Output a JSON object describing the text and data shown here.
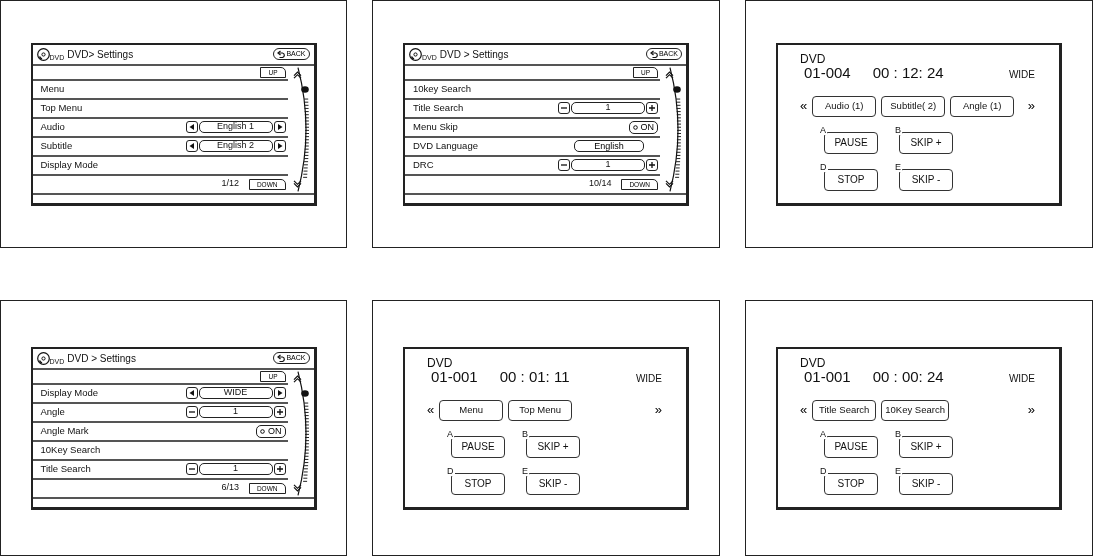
{
  "panels": [
    {
      "kind": "settings",
      "icon_label": "DVD",
      "breadcrumb": "DVD> Settings",
      "back": "BACK",
      "up": "UP",
      "rows": [
        {
          "kind": "plain",
          "label": "Menu"
        },
        {
          "kind": "plain",
          "label": "Top Menu"
        },
        {
          "kind": "arrows",
          "label": "Audio",
          "value": "English  1"
        },
        {
          "kind": "arrows",
          "label": "Subtitle",
          "value": "English  2"
        },
        {
          "kind": "plain",
          "label": "Display Mode"
        }
      ],
      "page": "1/12",
      "down": "DOWN"
    },
    {
      "kind": "settings",
      "icon_label": "DVD",
      "breadcrumb": "DVD > Settings",
      "back": "BACK",
      "up": "UP",
      "rows": [
        {
          "kind": "plain",
          "label": "10key Search"
        },
        {
          "kind": "stepper",
          "label": "Title Search",
          "value": "1"
        },
        {
          "kind": "toggle",
          "label": "Menu Skip",
          "value": "ON"
        },
        {
          "kind": "choice",
          "label": "DVD Language",
          "value": "English"
        },
        {
          "kind": "stepper",
          "label": "DRC",
          "value": "1"
        }
      ],
      "page": "10/14",
      "down": "DOWN"
    },
    {
      "kind": "player",
      "source": "DVD",
      "track": "01-004",
      "time": "00 : 12: 24",
      "mode": "WIDE",
      "prev": "«",
      "next": "»",
      "functions": [
        "Audio (1)",
        "Subtitle( 2)",
        "Angle (1)"
      ],
      "keys": [
        {
          "letter": "A",
          "label": "PAUSE"
        },
        {
          "letter": "B",
          "label": "SKIP +"
        },
        {
          "letter": "D",
          "label": "STOP"
        },
        {
          "letter": "E",
          "label": "SKIP -"
        }
      ]
    },
    {
      "kind": "settings",
      "icon_label": "DVD",
      "breadcrumb": "DVD > Settings",
      "back": "BACK",
      "up": "UP",
      "rows": [
        {
          "kind": "arrows",
          "label": "Display Mode",
          "value": "WIDE"
        },
        {
          "kind": "stepper",
          "label": "Angle",
          "value": "1"
        },
        {
          "kind": "toggle",
          "label": "Angle Mark",
          "value": "ON"
        },
        {
          "kind": "plain",
          "label": "10Key Search"
        },
        {
          "kind": "stepper",
          "label": "Title Search",
          "value": "1"
        }
      ],
      "page": "6/13",
      "down": "DOWN"
    },
    {
      "kind": "player",
      "source": "DVD",
      "track": "01-001",
      "time": "00 : 01: 11",
      "mode": "WIDE",
      "prev": "«",
      "next": "»",
      "functions": [
        "Menu",
        "Top Menu"
      ],
      "keys": [
        {
          "letter": "A",
          "label": "PAUSE"
        },
        {
          "letter": "B",
          "label": "SKIP +"
        },
        {
          "letter": "D",
          "label": "STOP"
        },
        {
          "letter": "E",
          "label": "SKIP -"
        }
      ]
    },
    {
      "kind": "player",
      "source": "DVD",
      "track": "01-001",
      "time": "00 : 00: 24",
      "mode": "WIDE",
      "prev": "«",
      "next": "»",
      "functions": [
        "Title Search",
        "10Key Search"
      ],
      "keys": [
        {
          "letter": "A",
          "label": "PAUSE"
        },
        {
          "letter": "B",
          "label": "SKIP +"
        },
        {
          "letter": "D",
          "label": "STOP"
        },
        {
          "letter": "E",
          "label": "SKIP -"
        }
      ]
    }
  ]
}
